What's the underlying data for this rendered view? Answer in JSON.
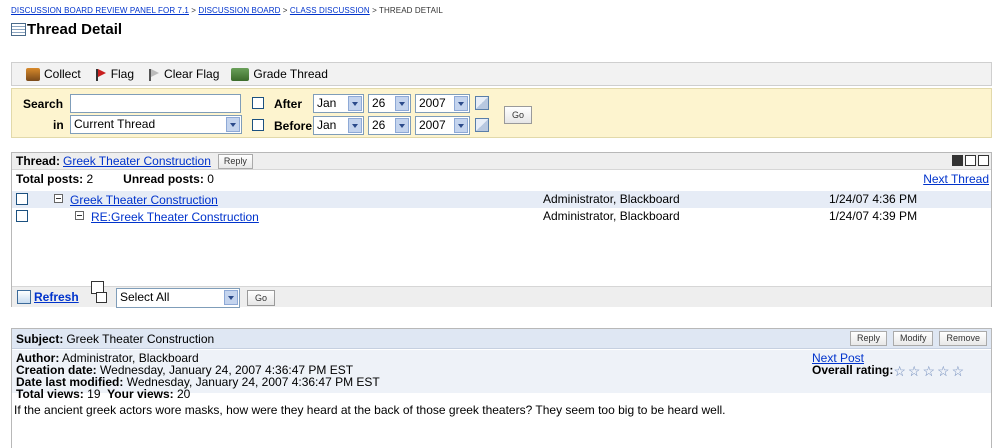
{
  "breadcrumb": {
    "items": [
      "DISCUSSION BOARD REVIEW PANEL FOR 7.1",
      "DISCUSSION BOARD",
      "CLASS DISCUSSION"
    ],
    "separator": ">",
    "current": "THREAD DETAIL"
  },
  "page_title": "Thread Detail",
  "toolbar": {
    "collect": "Collect",
    "flag": "Flag",
    "clear_flag": "Clear Flag",
    "grade_thread": "Grade Thread"
  },
  "search": {
    "label": "Search",
    "in_label": "in",
    "query": "",
    "scope": "Current Thread",
    "after_label": "After",
    "before_label": "Before",
    "after_month": "Jan",
    "after_day": "26",
    "after_year": "2007",
    "before_month": "Jan",
    "before_day": "26",
    "before_year": "2007",
    "go": "Go"
  },
  "thread": {
    "label": "Thread:",
    "title": "Greek Theater Construction",
    "reply": "Reply",
    "total_label": "Total posts:",
    "total": "2",
    "unread_label": "Unread posts:",
    "unread": "0",
    "next_thread": "Next Thread",
    "rows": [
      {
        "subject": "Greek Theater Construction",
        "author": "Administrator, Blackboard",
        "date": "1/24/07 4:36 PM"
      },
      {
        "subject": "RE:Greek Theater Construction",
        "author": "Administrator, Blackboard",
        "date": "1/24/07 4:39 PM"
      }
    ],
    "refresh": "Refresh",
    "bulk_action": "Select All",
    "go": "Go"
  },
  "post": {
    "subject_label": "Subject:",
    "subject": "Greek Theater Construction",
    "reply": "Reply",
    "modify": "Modify",
    "remove": "Remove",
    "author_label": "Author:",
    "author": "Administrator, Blackboard",
    "created_label": "Creation date:",
    "created": "Wednesday, January 24, 2007 4:36:47 PM EST",
    "modified_label": "Date last modified:",
    "modified": "Wednesday, January 24, 2007 4:36:47 PM EST",
    "total_views_label": "Total views:",
    "total_views": "19",
    "your_views_label": "Your views:",
    "your_views": "20",
    "next_post": "Next Post",
    "rating_label": "Overall rating:",
    "rating_stars": 0,
    "body": "If the ancient greek actors wore masks, how were they heard at the back of those greek theaters?  They seem too big to be heard well."
  },
  "colors": {
    "link": "#0033cc",
    "search_bg": "#fdf4cf",
    "selected_row": "#e6ecf6",
    "subject_header": "#dfe7f3"
  }
}
